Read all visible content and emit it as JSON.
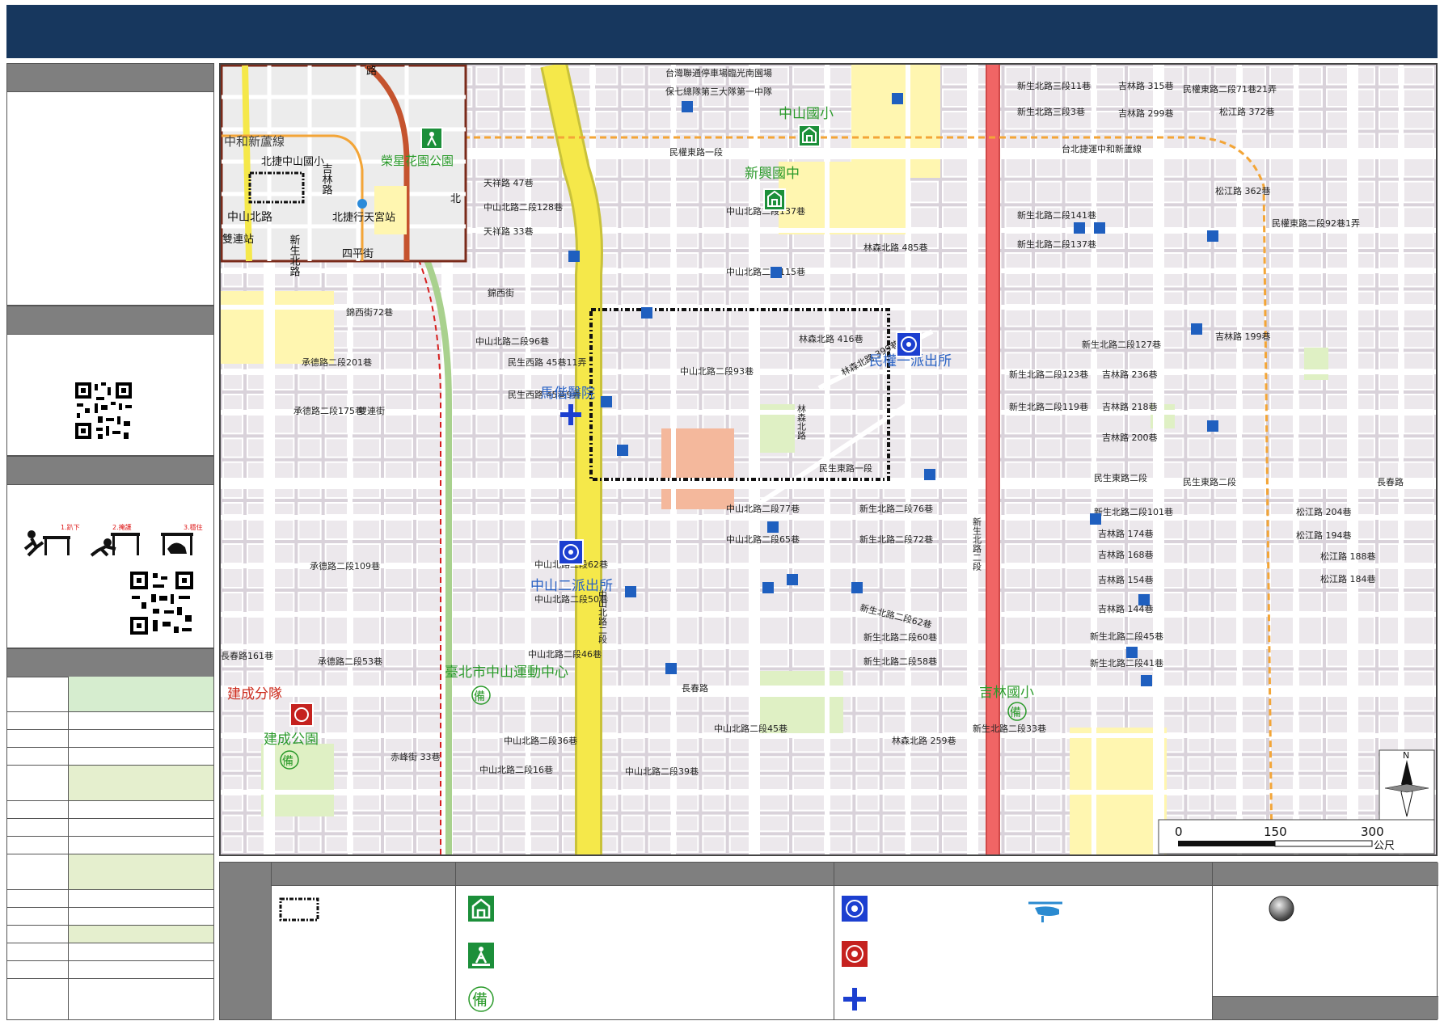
{
  "map": {
    "inset": {
      "line_label": "中和新蘆線",
      "labels": [
        "北捷中山國小",
        "吉林路",
        "榮星花園公園",
        "中山北路",
        "北捷行天宮站",
        "雙連站",
        "新生北路",
        "四平街",
        "北",
        "路"
      ]
    },
    "streets": [
      "民權東路一段",
      "台北捷運中和新蘆線",
      "新生北路三段11巷",
      "吉林路 315巷",
      "民權東路二段71巷21弄",
      "新生北路三段3巷",
      "吉林路 299巷",
      "松江路 372巷",
      "台灣聯通停車場臨光南園場",
      "保七總隊第三大隊第一中隊",
      "天祥路 47巷",
      "中山北路二段128巷",
      "天祥路 33巷",
      "中山北路二段137巷",
      "林森北路 485巷",
      "新生北路二段141巷",
      "新生北路二段137巷",
      "松江路 362巷",
      "民權東路二段92巷1弄",
      "中山北路二段115巷",
      "錦西街",
      "錦西街72巷",
      "中山北路二段96巷",
      "承德路二段201巷",
      "民生西路 45巷11弄",
      "民生西路 45巷9弄",
      "中山北路二段93巷",
      "林森北路 416巷",
      "林森北路 399巷",
      "新生北路二段127巷",
      "吉林路 236巷",
      "吉林路 218巷",
      "吉林路 199巷",
      "新生北路二段123巷",
      "新生北路二段119巷",
      "吉林路 200巷",
      "承德路二段175巷",
      "雙連街",
      "民生東路一段",
      "民生東路二段",
      "中山北路二段77巷",
      "新生北路二段76巷",
      "新生北路二段101巷",
      "松江路 204巷",
      "吉林路 174巷",
      "松江路 194巷",
      "中山北路二段65巷",
      "新生北路二段72巷",
      "吉林路 168巷",
      "松江路 188巷",
      "承德路二段109巷",
      "中山北路二段62巷",
      "吉林路 154巷",
      "松江路 184巷",
      "中山北路二段50巷",
      "新生北路二段62巷",
      "吉林路 144巷",
      "新生北路二段60巷",
      "新生北路二段45巷",
      "長春路161巷",
      "承德路二段53巷",
      "中山北路二段46巷",
      "新生北路二段58巷",
      "新生北路二段41巷",
      "長春路",
      "中山北路二段45巷",
      "新生北路二段33巷",
      "林森北路 259巷",
      "赤峰街 33巷",
      "中山北路二段36巷",
      "中山北路二段16巷",
      "中山北路二段39巷",
      "中山北路二段",
      "新生北路二段",
      "林森北路",
      "長春路",
      "民生東路二段"
    ],
    "landmarks": {
      "zhongshan_elem": "中山國小",
      "xinxing_jh": "新興國中",
      "mackay": "馬偕醫院",
      "minquan_police": "民權一派出所",
      "zhongshan2_police": "中山二派出所",
      "jiancheng_fire": "建成分隊",
      "sports_center": "臺北市中山運動中心",
      "jianchen_park": "建成公園",
      "jilin_elem": "吉林國小"
    },
    "scale": {
      "ticks": [
        "0",
        "150",
        "300"
      ],
      "unit": "公尺"
    },
    "north_label": "N"
  },
  "left_panel": {
    "earthquake_steps": [
      "1.趴下",
      "2.掩護",
      "3.穩住"
    ]
  },
  "legend": {
    "icons": [
      "evacuation-shelter",
      "park-refuge",
      "standby-shelter",
      "police-station",
      "fire-station",
      "hospital",
      "helicopter",
      "node"
    ]
  },
  "colors": {
    "banner": "#17375e",
    "major_road": "#f5e84a",
    "mrt_line": "#f3a537",
    "red_road": "#f06565",
    "green_area": "#dff0c4",
    "school_area": "#fff6b0"
  }
}
